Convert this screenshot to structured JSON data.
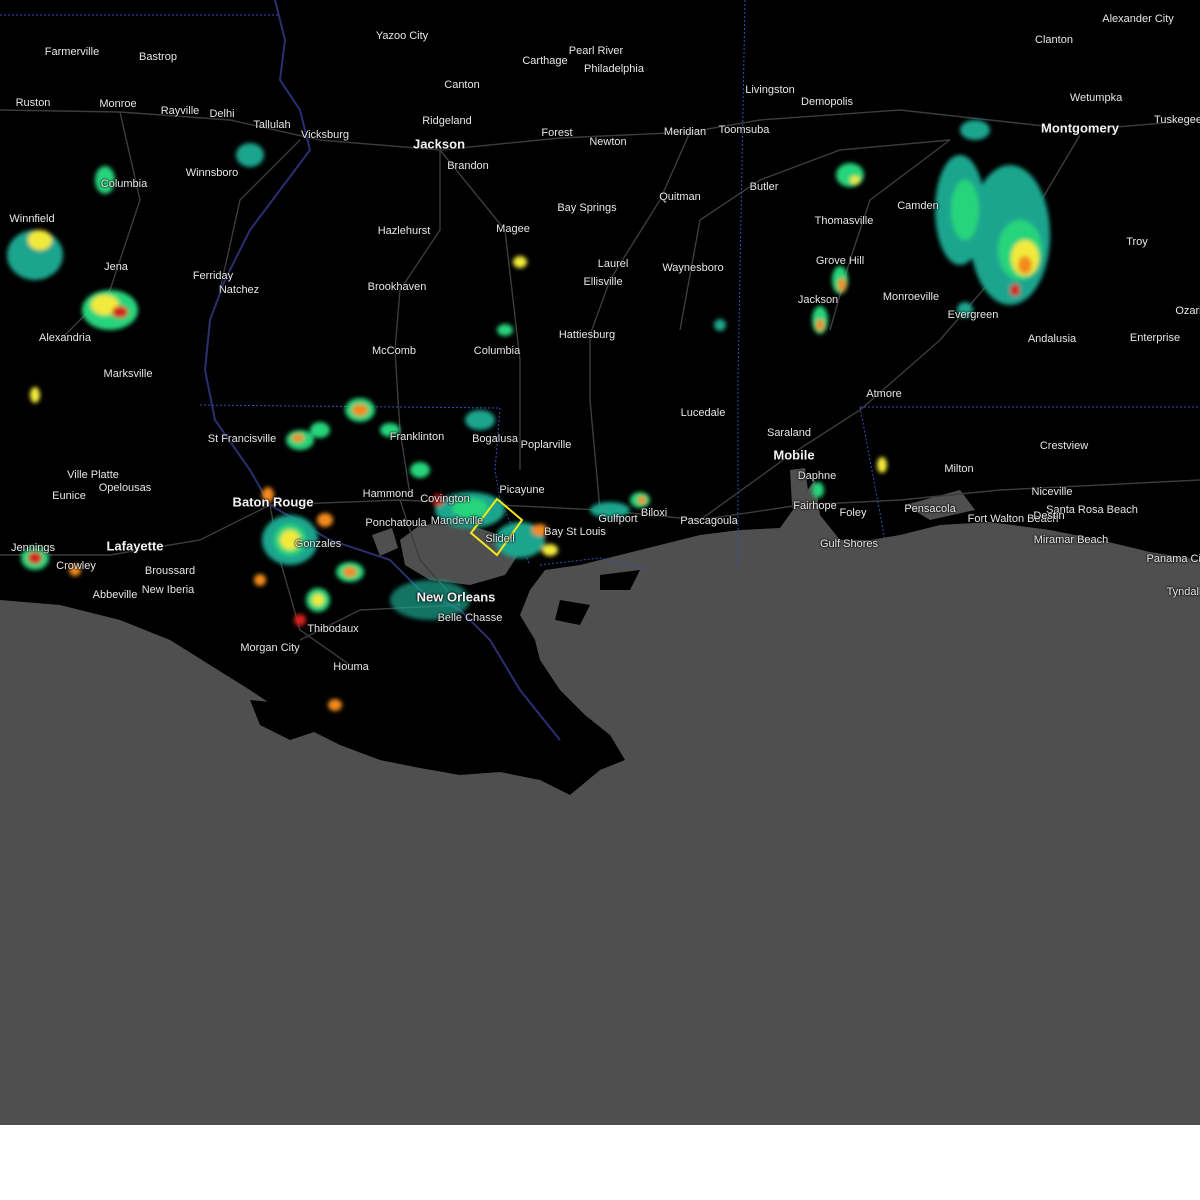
{
  "cities": [
    {
      "name": "Farmerville",
      "major": false
    },
    {
      "name": "Bastrop",
      "major": false
    },
    {
      "name": "Yazoo City",
      "major": false
    },
    {
      "name": "Carthage",
      "major": false
    },
    {
      "name": "Pearl River",
      "major": false
    },
    {
      "name": "Philadelphia",
      "major": false
    },
    {
      "name": "Clanton",
      "major": false
    },
    {
      "name": "Alexander City",
      "major": false
    },
    {
      "name": "Ruston",
      "major": false
    },
    {
      "name": "Monroe",
      "major": false
    },
    {
      "name": "Rayville",
      "major": false
    },
    {
      "name": "Delhi",
      "major": false
    },
    {
      "name": "Tallulah",
      "major": false
    },
    {
      "name": "Vicksburg",
      "major": false
    },
    {
      "name": "Canton",
      "major": false
    },
    {
      "name": "Ridgeland",
      "major": false
    },
    {
      "name": "Jackson",
      "major": true
    },
    {
      "name": "Brandon",
      "major": false
    },
    {
      "name": "Forest",
      "major": false
    },
    {
      "name": "Newton",
      "major": false
    },
    {
      "name": "Meridian",
      "major": false
    },
    {
      "name": "Toomsuba",
      "major": false
    },
    {
      "name": "Livingston",
      "major": false
    },
    {
      "name": "Demopolis",
      "major": false
    },
    {
      "name": "Wetumpka",
      "major": false
    },
    {
      "name": "Montgomery",
      "major": true
    },
    {
      "name": "Tuskegee",
      "major": false
    },
    {
      "name": "Columbia",
      "major": false
    },
    {
      "name": "Winnsboro",
      "major": false
    },
    {
      "name": "Quitman",
      "major": false
    },
    {
      "name": "Butler",
      "major": false
    },
    {
      "name": "Thomasville",
      "major": false
    },
    {
      "name": "Camden",
      "major": false
    },
    {
      "name": "Bay Springs",
      "major": false
    },
    {
      "name": "Winnfield",
      "major": false
    },
    {
      "name": "Hazlehurst",
      "major": false
    },
    {
      "name": "Magee",
      "major": false
    },
    {
      "name": "Troy",
      "major": false
    },
    {
      "name": "Jena",
      "major": false
    },
    {
      "name": "Ferriday",
      "major": false
    },
    {
      "name": "Natchez",
      "major": false
    },
    {
      "name": "Laurel",
      "major": false
    },
    {
      "name": "Ellisville",
      "major": false
    },
    {
      "name": "Waynesboro",
      "major": false
    },
    {
      "name": "Grove Hill",
      "major": false
    },
    {
      "name": "Brookhaven",
      "major": false
    },
    {
      "name": "Jackson",
      "major": false
    },
    {
      "name": "Monroeville",
      "major": false
    },
    {
      "name": "Evergreen",
      "major": false
    },
    {
      "name": "Ozark",
      "major": false
    },
    {
      "name": "Alexandria",
      "major": false
    },
    {
      "name": "Hattiesburg",
      "major": false
    },
    {
      "name": "Andalusia",
      "major": false
    },
    {
      "name": "Enterprise",
      "major": false
    },
    {
      "name": "McComb",
      "major": false
    },
    {
      "name": "Columbia",
      "major": false
    },
    {
      "name": "Marksville",
      "major": false
    },
    {
      "name": "Atmore",
      "major": false
    },
    {
      "name": "Lucedale",
      "major": false
    },
    {
      "name": "Saraland",
      "major": false
    },
    {
      "name": "St Francisville",
      "major": false
    },
    {
      "name": "Franklinton",
      "major": false
    },
    {
      "name": "Bogalusa",
      "major": false
    },
    {
      "name": "Poplarville",
      "major": false
    },
    {
      "name": "Crestview",
      "major": false
    },
    {
      "name": "Mobile",
      "major": true
    },
    {
      "name": "Ville Platte",
      "major": false
    },
    {
      "name": "Daphne",
      "major": false
    },
    {
      "name": "Milton",
      "major": false
    },
    {
      "name": "Opelousas",
      "major": false
    },
    {
      "name": "Picayune",
      "major": false
    },
    {
      "name": "Eunice",
      "major": false
    },
    {
      "name": "Hammond",
      "major": false
    },
    {
      "name": "Covington",
      "major": false
    },
    {
      "name": "Niceville",
      "major": false
    },
    {
      "name": "Baton Rouge",
      "major": true
    },
    {
      "name": "Fairhope",
      "major": false
    },
    {
      "name": "Foley",
      "major": false
    },
    {
      "name": "Pensacola",
      "major": false
    },
    {
      "name": "Santa Rosa Beach",
      "major": false
    },
    {
      "name": "Fort Walton Beach",
      "major": false
    },
    {
      "name": "Destin",
      "major": false
    },
    {
      "name": "Gulfport",
      "major": false
    },
    {
      "name": "Biloxi",
      "major": false
    },
    {
      "name": "Pascagoula",
      "major": false
    },
    {
      "name": "Ponchatoula",
      "major": false
    },
    {
      "name": "Mandeville",
      "major": false
    },
    {
      "name": "Bay St Louis",
      "major": false
    },
    {
      "name": "Slidell",
      "major": false
    },
    {
      "name": "Miramar Beach",
      "major": false
    },
    {
      "name": "Lafayette",
      "major": true
    },
    {
      "name": "Gonzales",
      "major": false
    },
    {
      "name": "Gulf Shores",
      "major": false
    },
    {
      "name": "Jennings",
      "major": false
    },
    {
      "name": "Crowley",
      "major": false
    },
    {
      "name": "Broussard",
      "major": false
    },
    {
      "name": "Panama City",
      "major": false
    },
    {
      "name": "New Iberia",
      "major": false
    },
    {
      "name": "Abbeville",
      "major": false
    },
    {
      "name": "New Orleans",
      "major": true
    },
    {
      "name": "Belle Chasse",
      "major": false
    },
    {
      "name": "Tyndall",
      "major": false
    },
    {
      "name": "Thibodaux",
      "major": false
    },
    {
      "name": "Morgan City",
      "major": false
    },
    {
      "name": "Houma",
      "major": false
    }
  ],
  "colors": {
    "land": "#000000",
    "water": "#4f4f4f",
    "state_border": "#3a4dbb",
    "roads": "#3c3c3c",
    "warning_polygon": "#f5e61c",
    "radar_light": "#1ca58e",
    "radar_mid": "#28d47c",
    "radar_yellow": "#f2ea3a",
    "radar_orange": "#f28a1e",
    "radar_red": "#d4201e"
  }
}
